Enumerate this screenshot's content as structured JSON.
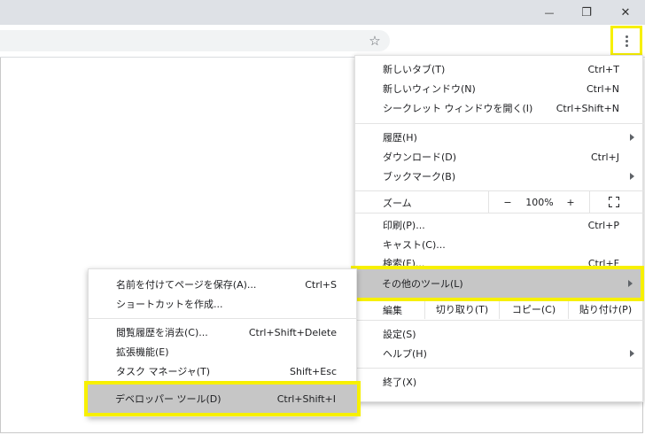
{
  "window": {
    "minimize_label": "—",
    "restore_label": "❐",
    "close_label": "✕"
  },
  "toolbar": {
    "bookmark_star": "☆"
  },
  "main_menu": {
    "items": [
      {
        "label": "新しいタブ(T)",
        "shortcut": "Ctrl+T"
      },
      {
        "label": "新しいウィンドウ(N)",
        "shortcut": "Ctrl+N"
      },
      {
        "label": "シークレット ウィンドウを開く(I)",
        "shortcut": "Ctrl+Shift+N"
      },
      {
        "label": "履歴(H)",
        "shortcut": ""
      },
      {
        "label": "ダウンロード(D)",
        "shortcut": "Ctrl+J"
      },
      {
        "label": "ブックマーク(B)",
        "shortcut": ""
      },
      {
        "label": "印刷(P)...",
        "shortcut": "Ctrl+P"
      },
      {
        "label": "キャスト(C)...",
        "shortcut": ""
      },
      {
        "label": "検索(F)...",
        "shortcut": "Ctrl+F"
      },
      {
        "label": "その他のツール(L)",
        "shortcut": ""
      },
      {
        "label": "設定(S)",
        "shortcut": ""
      },
      {
        "label": "ヘルプ(H)",
        "shortcut": ""
      },
      {
        "label": "終了(X)",
        "shortcut": ""
      }
    ],
    "zoom": {
      "label": "ズーム",
      "minus": "−",
      "value": "100%",
      "plus": "+"
    },
    "edit": {
      "label": "編集",
      "cut": "切り取り(T)",
      "copy": "コピー(C)",
      "paste": "貼り付け(P)"
    }
  },
  "sub_menu": {
    "items": [
      {
        "label": "名前を付けてページを保存(A)...",
        "shortcut": "Ctrl+S"
      },
      {
        "label": "ショートカットを作成...",
        "shortcut": ""
      },
      {
        "label": "閲覧履歴を消去(C)...",
        "shortcut": "Ctrl+Shift+Delete"
      },
      {
        "label": "拡張機能(E)",
        "shortcut": ""
      },
      {
        "label": "タスク マネージャ(T)",
        "shortcut": "Shift+Esc"
      },
      {
        "label": "デベロッパー ツール(D)",
        "shortcut": "Ctrl+Shift+I"
      }
    ]
  },
  "colors": {
    "highlight": "#f7f000",
    "selected": "#c6c6c6"
  }
}
